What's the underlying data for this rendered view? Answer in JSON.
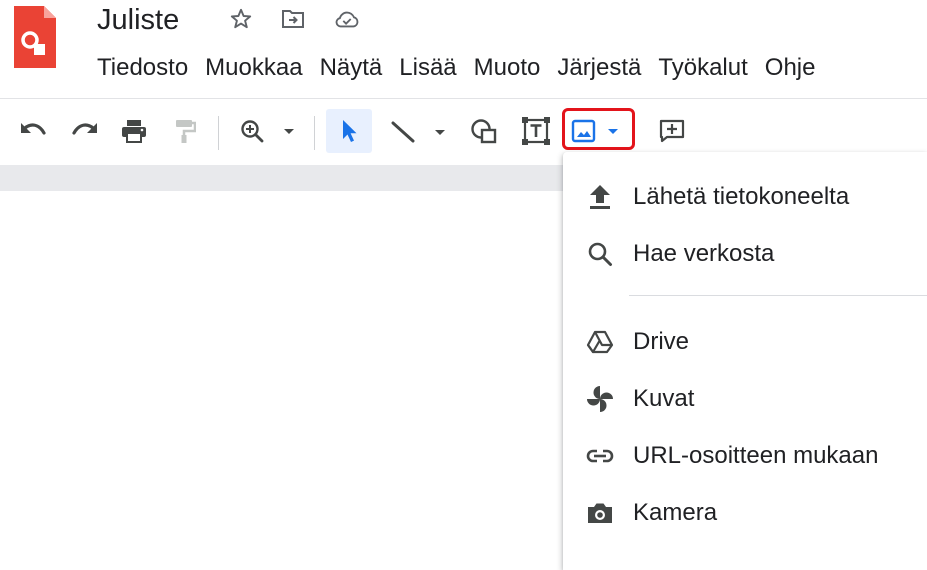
{
  "app": {
    "title": "Juliste",
    "icons": [
      "google-drawings-logo-icon",
      "star-icon",
      "move-to-folder-icon",
      "cloud-saved-icon"
    ],
    "brand_color": "#ea4335"
  },
  "menubar": {
    "items": [
      "Tiedosto",
      "Muokkaa",
      "Näytä",
      "Lisää",
      "Muoto",
      "Järjestä",
      "Työkalut",
      "Ohje"
    ]
  },
  "toolbar": {
    "buttons": [
      "undo-icon",
      "redo-icon",
      "print-icon",
      "paint-format-icon",
      "zoom-icon",
      "select-icon",
      "line-icon",
      "shape-icon",
      "text-box-icon",
      "image-icon",
      "comment-icon"
    ],
    "active_tool": "select",
    "highlight_color": "#e3141b",
    "accent_color": "#1a73e8"
  },
  "image_menu": {
    "items": [
      {
        "icon": "upload-icon",
        "label": "Lähetä tietokoneelta"
      },
      {
        "icon": "search-icon",
        "label": "Hae verkosta"
      },
      {
        "icon": "drive-icon",
        "label": "Drive"
      },
      {
        "icon": "pinwheel-icon",
        "label": "Kuvat"
      },
      {
        "icon": "link-icon",
        "label": "URL-osoitteen mukaan"
      },
      {
        "icon": "camera-icon",
        "label": "Kamera"
      }
    ]
  }
}
